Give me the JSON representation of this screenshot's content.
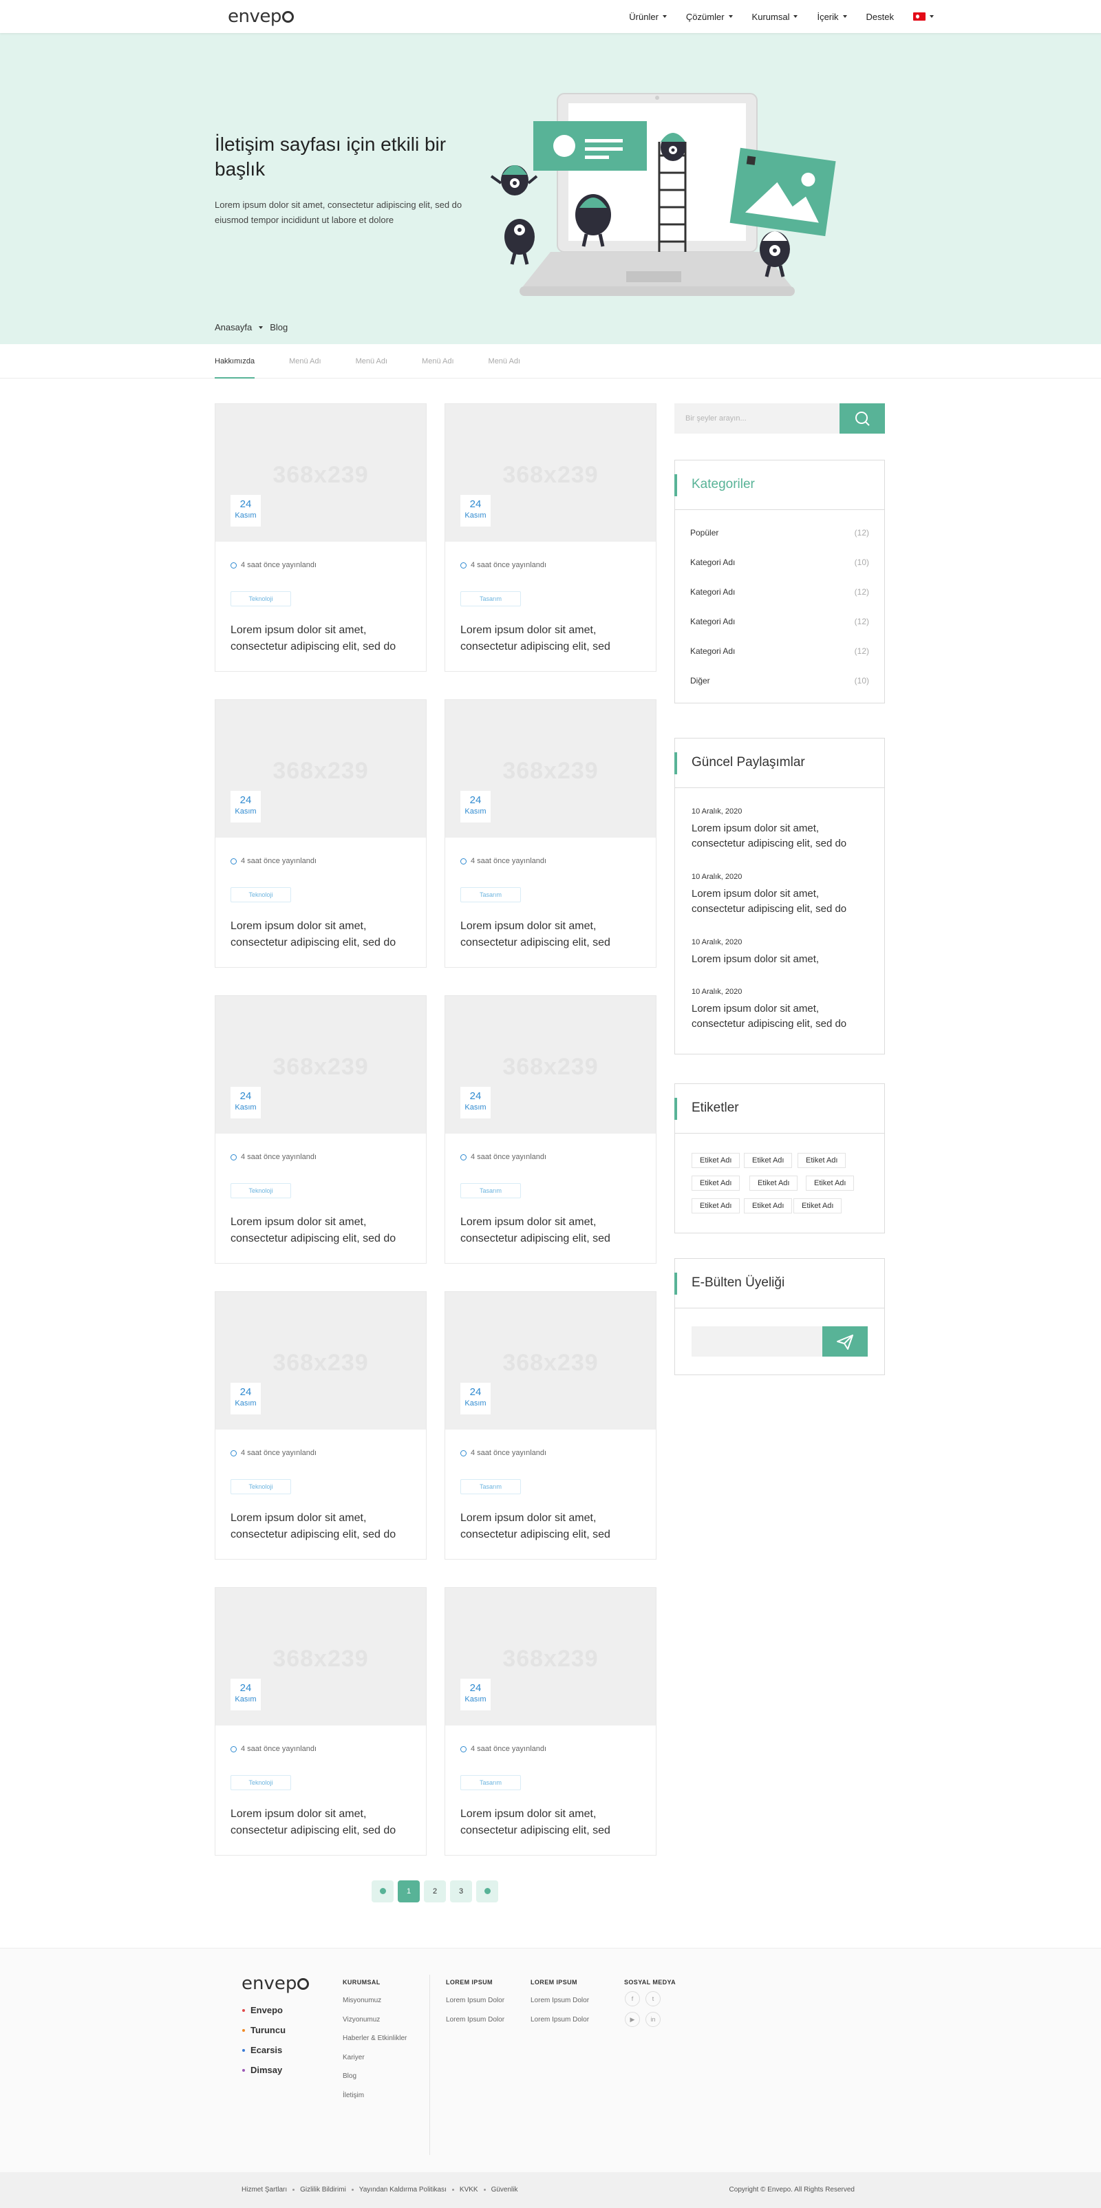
{
  "header": {
    "logo": "envep",
    "nav": [
      {
        "label": "Ürünler",
        "has_caret": true
      },
      {
        "label": "Çözümler",
        "has_caret": true
      },
      {
        "label": "Kurumsal",
        "has_caret": true
      },
      {
        "label": "İçerik",
        "has_caret": true
      },
      {
        "label": "Destek",
        "has_caret": false
      }
    ],
    "language_flag": "tr-flag-icon"
  },
  "hero": {
    "title": "İletişim sayfası için etkili bir başlık",
    "text": "Lorem ipsum dolor sit amet, consectetur adipiscing elit, sed do eiusmod tempor incididunt ut labore et dolore",
    "breadcrumb": [
      "Anasayfa",
      "Blog"
    ],
    "bg_color": "#e1f3ed",
    "accent_color": "#58b397"
  },
  "tabs": [
    "Hakkımızda",
    "Menü Adı",
    "Menü Adı",
    "Menü Adı",
    "Menü Adı"
  ],
  "cards": [
    {
      "placeholder": "368x239",
      "day": "24",
      "month": "Kasım",
      "meta": "4 saat önce yayınlandı",
      "tag": "Teknoloji",
      "title": "Lorem ipsum dolor sit amet, consectetur adipiscing elit, sed do"
    },
    {
      "placeholder": "368x239",
      "day": "24",
      "month": "Kasım",
      "meta": "4 saat önce yayınlandı",
      "tag": "Tasarım",
      "title": "Lorem ipsum dolor sit amet, consectetur adipiscing elit, sed"
    },
    {
      "placeholder": "368x239",
      "day": "24",
      "month": "Kasım",
      "meta": "4 saat önce yayınlandı",
      "tag": "Teknoloji",
      "title": "Lorem ipsum dolor sit amet, consectetur adipiscing elit, sed do"
    },
    {
      "placeholder": "368x239",
      "day": "24",
      "month": "Kasım",
      "meta": "4 saat önce yayınlandı",
      "tag": "Tasarım",
      "title": "Lorem ipsum dolor sit amet, consectetur adipiscing elit, sed"
    },
    {
      "placeholder": "368x239",
      "day": "24",
      "month": "Kasım",
      "meta": "4 saat önce yayınlandı",
      "tag": "Teknoloji",
      "title": "Lorem ipsum dolor sit amet, consectetur adipiscing elit, sed do"
    },
    {
      "placeholder": "368x239",
      "day": "24",
      "month": "Kasım",
      "meta": "4 saat önce yayınlandı",
      "tag": "Tasarım",
      "title": "Lorem ipsum dolor sit amet, consectetur adipiscing elit, sed"
    },
    {
      "placeholder": "368x239",
      "day": "24",
      "month": "Kasım",
      "meta": "4 saat önce yayınlandı",
      "tag": "Teknoloji",
      "title": "Lorem ipsum dolor sit amet, consectetur adipiscing elit, sed do"
    },
    {
      "placeholder": "368x239",
      "day": "24",
      "month": "Kasım",
      "meta": "4 saat önce yayınlandı",
      "tag": "Tasarım",
      "title": "Lorem ipsum dolor sit amet, consectetur adipiscing elit, sed"
    },
    {
      "placeholder": "368x239",
      "day": "24",
      "month": "Kasım",
      "meta": "4 saat önce yayınlandı",
      "tag": "Teknoloji",
      "title": "Lorem ipsum dolor sit amet, consectetur adipiscing elit, sed do"
    },
    {
      "placeholder": "368x239",
      "day": "24",
      "month": "Kasım",
      "meta": "4 saat önce yayınlandı",
      "tag": "Tasarım",
      "title": "Lorem ipsum dolor sit amet, consectetur adipiscing elit, sed"
    }
  ],
  "pagination": {
    "pages": [
      "1",
      "2",
      "3"
    ],
    "current": "1"
  },
  "sidebar": {
    "search_placeholder": "Bir şeyler arayın...",
    "categories": {
      "title": "Kategoriler",
      "items": [
        {
          "label": "Popüler",
          "count": "(12)"
        },
        {
          "label": "Kategori Adı",
          "count": "(10)"
        },
        {
          "label": "Kategori Adı",
          "count": "(12)"
        },
        {
          "label": "Kategori Adı",
          "count": "(12)"
        },
        {
          "label": "Kategori Adı",
          "count": "(12)"
        },
        {
          "label": "Diğer",
          "count": "(10)"
        }
      ]
    },
    "recent": {
      "title": "Güncel Paylaşımlar",
      "items": [
        {
          "date": "10 Aralık, 2020",
          "title": "Lorem ipsum dolor sit amet, consectetur adipiscing elit, sed do"
        },
        {
          "date": "10 Aralık, 2020",
          "title": "Lorem ipsum dolor sit amet, consectetur adipiscing elit, sed do"
        },
        {
          "date": "10 Aralık, 2020",
          "title": "Lorem ipsum dolor sit amet,"
        },
        {
          "date": "10 Aralık, 2020",
          "title": "Lorem ipsum dolor sit amet, consectetur adipiscing elit, sed do"
        }
      ]
    },
    "tags": {
      "title": "Etiketler",
      "items": [
        "Etiket Adı",
        "Etiket Adı",
        "Etiket Adı",
        "Etiket Adı",
        "Etiket Adı",
        "Etiket Adı",
        "Etiket Adı",
        "Etiket Adı",
        "Etiket Adı"
      ]
    },
    "newsletter": {
      "title": "E-Bülten Üyeliği"
    }
  },
  "footer": {
    "logo": "envep",
    "brands": [
      {
        "name": "Envepo",
        "color": "#e04a4a"
      },
      {
        "name": "Turuncu",
        "color": "#f08a24"
      },
      {
        "name": "Ecarsis",
        "color": "#3a7bd5"
      },
      {
        "name": "Dimsay",
        "color": "#9b59b6"
      }
    ],
    "col1": {
      "title": "KURUMSAL",
      "links": [
        "Misyonumuz",
        "Vizyonumuz",
        "Haberler & Etkinlikler",
        "Kariyer",
        "Blog",
        "İletişim"
      ]
    },
    "col2": {
      "title": "LOREM IPSUM",
      "links": [
        "Lorem Ipsum Dolor",
        "Lorem Ipsum Dolor"
      ]
    },
    "col3": {
      "title": "LOREM IPSUM",
      "links": [
        "Lorem Ipsum Dolor",
        "Lorem Ipsum Dolor"
      ]
    },
    "social": {
      "title": "SOSYAL MEDYA",
      "icons": [
        "f",
        "t",
        "▶",
        "in"
      ]
    },
    "legal": [
      "Hizmet Şartları",
      "Gizlilik Bildirimi",
      "Yayından Kaldırma Politikası",
      "KVKK",
      "Güvenlik"
    ],
    "copyright": "Copyright © Envepo. All Rights Reserved"
  }
}
